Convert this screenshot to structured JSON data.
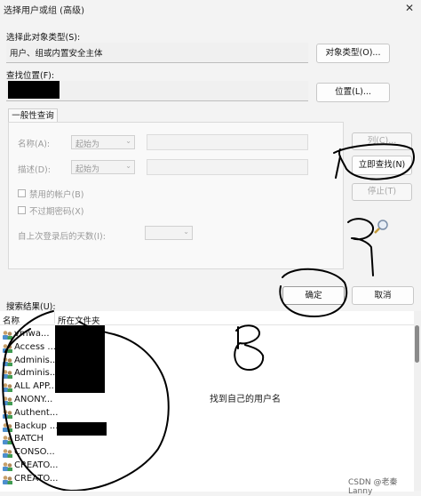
{
  "window": {
    "title": "选择用户或组 (高级)",
    "close_glyph": "✕"
  },
  "object_type": {
    "label": "选择此对象类型(S):",
    "value": "用户、组或内置安全主体",
    "button": "对象类型(O)..."
  },
  "location": {
    "label": "查找位置(F):",
    "button": "位置(L)..."
  },
  "query": {
    "tab": "一般性查询",
    "name_label": "名称(A):",
    "name_mode": "起始为",
    "desc_label": "描述(D):",
    "desc_mode": "起始为",
    "disabled_accounts": "禁用的帐户(B)",
    "non_expiring_pw": "不过期密码(X)",
    "days_since_logon": "自上次登录后的天数(I):",
    "columns_button": "列(C)...",
    "find_now_button": "立即查找(N)",
    "stop_button": "停止(T)"
  },
  "actions": {
    "ok": "确定",
    "cancel": "取消"
  },
  "results": {
    "label": "搜索结果(U):",
    "col_name": "名称",
    "col_folder": "所在文件夹",
    "rows": [
      "vmwa...",
      "Access ...",
      "Adminis...",
      "Adminis...",
      "ALL APP...",
      "ANONY...",
      "Authent...",
      "Backup ...",
      "BATCH",
      "CONSO...",
      "CREATO...",
      "CREATO..."
    ]
  },
  "annotation": {
    "note": "找到自己的用户名"
  },
  "watermark": "CSDN @老秦Lanny"
}
